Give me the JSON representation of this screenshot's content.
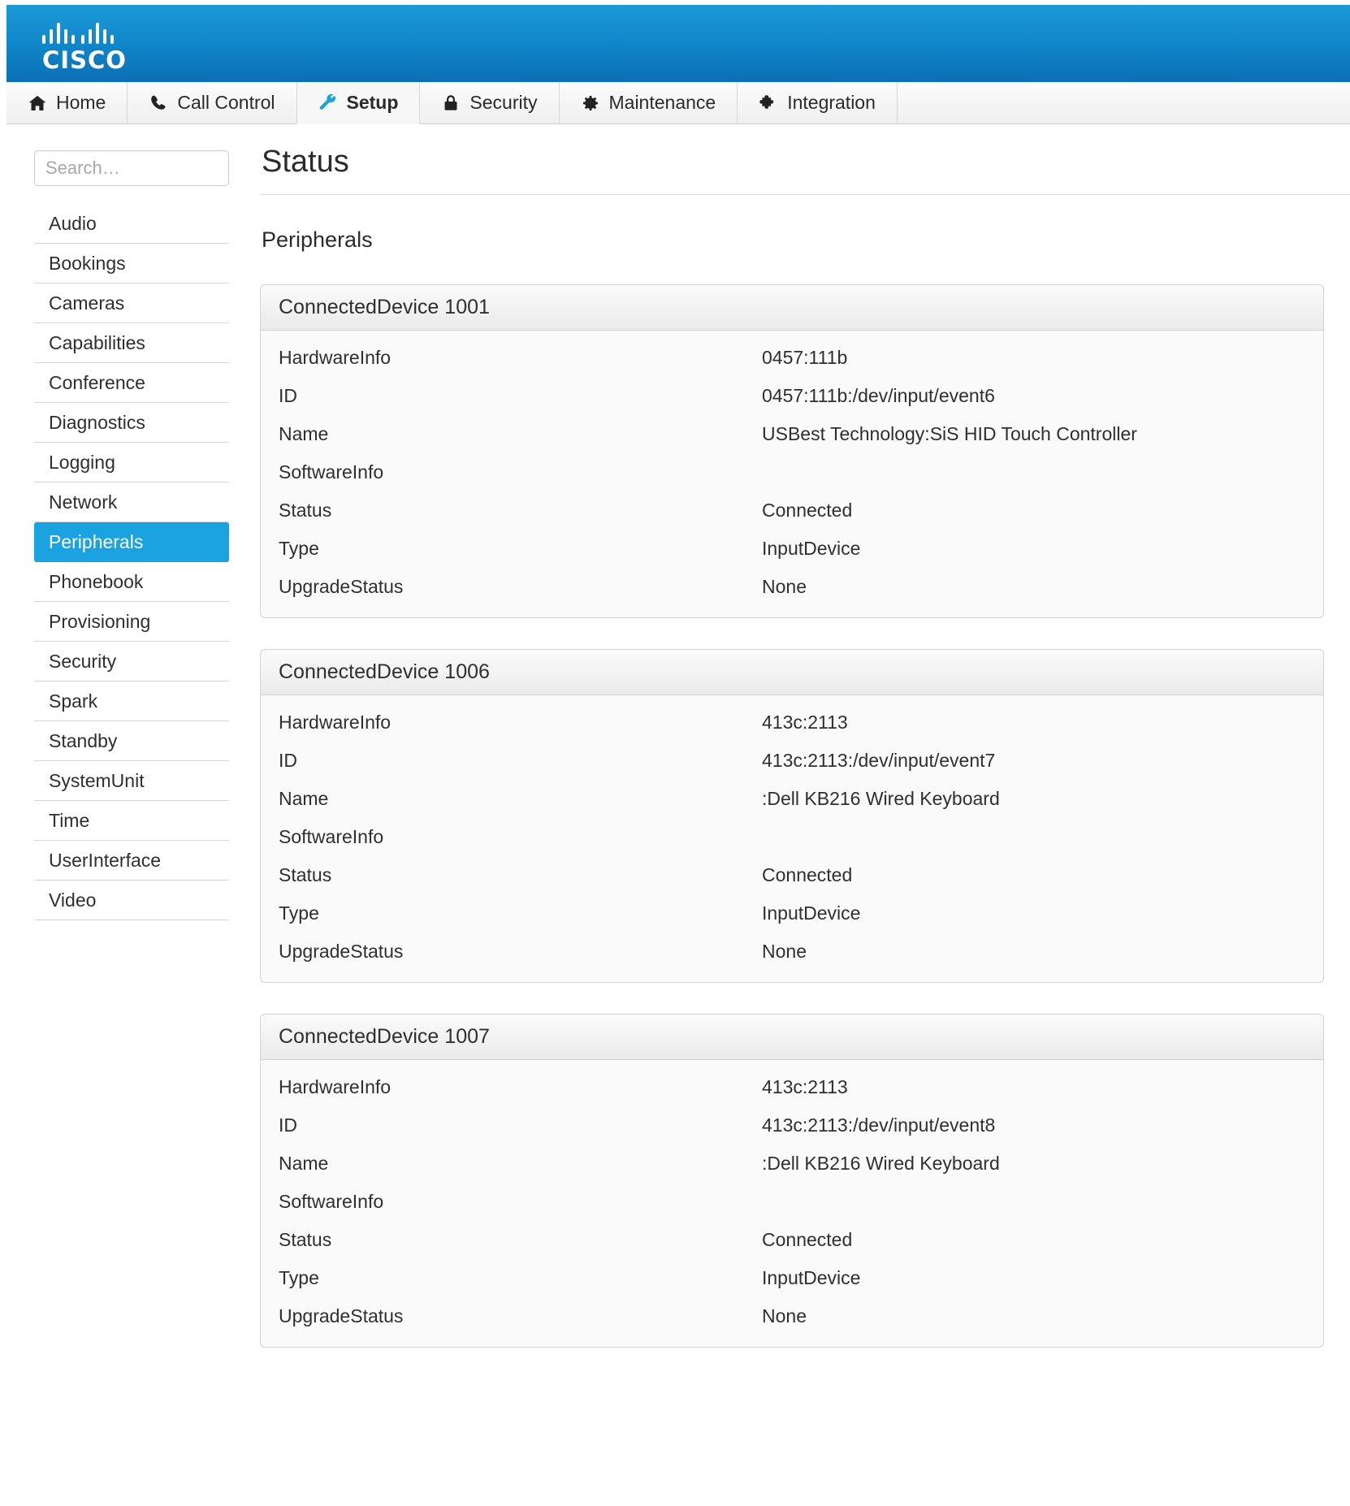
{
  "brand": {
    "name": "CISCO",
    "logo_icon": "cisco-logo-icon"
  },
  "nav": {
    "tabs": [
      {
        "label": "Home",
        "icon": "home-icon",
        "active": false
      },
      {
        "label": "Call Control",
        "icon": "phone-icon",
        "active": false
      },
      {
        "label": "Setup",
        "icon": "wrench-icon",
        "active": true
      },
      {
        "label": "Security",
        "icon": "lock-icon",
        "active": false
      },
      {
        "label": "Maintenance",
        "icon": "gear-icon",
        "active": false
      },
      {
        "label": "Integration",
        "icon": "puzzle-piece-icon",
        "active": false
      }
    ]
  },
  "sidebar": {
    "search": {
      "placeholder": "Search…",
      "value": ""
    },
    "items": [
      {
        "label": "Audio",
        "active": false
      },
      {
        "label": "Bookings",
        "active": false
      },
      {
        "label": "Cameras",
        "active": false
      },
      {
        "label": "Capabilities",
        "active": false
      },
      {
        "label": "Conference",
        "active": false
      },
      {
        "label": "Diagnostics",
        "active": false
      },
      {
        "label": "Logging",
        "active": false
      },
      {
        "label": "Network",
        "active": false
      },
      {
        "label": "Peripherals",
        "active": true
      },
      {
        "label": "Phonebook",
        "active": false
      },
      {
        "label": "Provisioning",
        "active": false
      },
      {
        "label": "Security",
        "active": false
      },
      {
        "label": "Spark",
        "active": false
      },
      {
        "label": "Standby",
        "active": false
      },
      {
        "label": "SystemUnit",
        "active": false
      },
      {
        "label": "Time",
        "active": false
      },
      {
        "label": "UserInterface",
        "active": false
      },
      {
        "label": "Video",
        "active": false
      }
    ]
  },
  "main": {
    "title": "Status",
    "section": "Peripherals",
    "panels": [
      {
        "title": "ConnectedDevice 1001",
        "rows": [
          {
            "key": "HardwareInfo",
            "value": "0457:111b"
          },
          {
            "key": "ID",
            "value": "0457:111b:/dev/input/event6"
          },
          {
            "key": "Name",
            "value": "USBest Technology:SiS HID Touch Controller"
          },
          {
            "key": "SoftwareInfo",
            "value": ""
          },
          {
            "key": "Status",
            "value": "Connected"
          },
          {
            "key": "Type",
            "value": "InputDevice"
          },
          {
            "key": "UpgradeStatus",
            "value": "None"
          }
        ]
      },
      {
        "title": "ConnectedDevice 1006",
        "rows": [
          {
            "key": "HardwareInfo",
            "value": "413c:2113"
          },
          {
            "key": "ID",
            "value": "413c:2113:/dev/input/event7"
          },
          {
            "key": "Name",
            "value": ":Dell KB216 Wired Keyboard"
          },
          {
            "key": "SoftwareInfo",
            "value": ""
          },
          {
            "key": "Status",
            "value": "Connected"
          },
          {
            "key": "Type",
            "value": "InputDevice"
          },
          {
            "key": "UpgradeStatus",
            "value": "None"
          }
        ]
      },
      {
        "title": "ConnectedDevice 1007",
        "rows": [
          {
            "key": "HardwareInfo",
            "value": "413c:2113"
          },
          {
            "key": "ID",
            "value": "413c:2113:/dev/input/event8"
          },
          {
            "key": "Name",
            "value": ":Dell KB216 Wired Keyboard"
          },
          {
            "key": "SoftwareInfo",
            "value": ""
          },
          {
            "key": "Status",
            "value": "Connected"
          },
          {
            "key": "Type",
            "value": "InputDevice"
          },
          {
            "key": "UpgradeStatus",
            "value": "None"
          }
        ]
      }
    ]
  },
  "colors": {
    "brand_blue_light": "#1c9ad6",
    "brand_blue_dark": "#0b6fb4",
    "accent_active": "#1aa3e0",
    "text": "#2f2f2f"
  }
}
